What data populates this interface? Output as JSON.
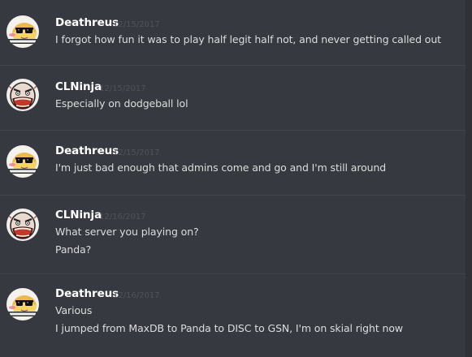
{
  "messages": [
    {
      "author": "Deathreus",
      "avatar_icon": "sunglasses-pie-icon",
      "timestamp": "12/15/2017",
      "lines": [
        "I forgot how fun it was to play half legit half not, and never getting called out"
      ]
    },
    {
      "author": "CLNinja",
      "avatar_icon": "rage-face-icon",
      "timestamp": "12/15/2017",
      "lines": [
        "Especially on dodgeball lol"
      ]
    },
    {
      "author": "Deathreus",
      "avatar_icon": "sunglasses-pie-icon",
      "timestamp": "12/15/2017",
      "lines": [
        "I'm just bad enough that admins come and go and I'm still around"
      ]
    },
    {
      "author": "CLNinja",
      "avatar_icon": "rage-face-icon",
      "timestamp": "12/16/2017",
      "lines": [
        "What server you playing on?",
        "Panda?"
      ]
    },
    {
      "author": "Deathreus",
      "avatar_icon": "sunglasses-pie-icon",
      "timestamp": "12/16/2017",
      "lines": [
        "Various",
        "I jumped from MaxDB to Panda to DISC to GSN, I'm on skial right now"
      ]
    }
  ],
  "colors": {
    "background": "#36393f",
    "username": "#ffffff",
    "timestamp": "#50535a",
    "text": "#dcddde",
    "divider": "#42454a"
  }
}
